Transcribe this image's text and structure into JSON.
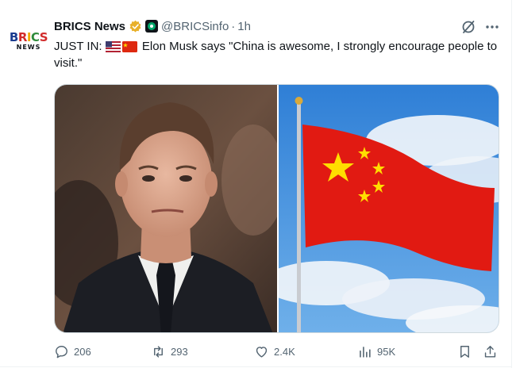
{
  "tweet": {
    "author": {
      "display_name": "BRICS News",
      "handle": "@BRICSinfo",
      "time": "1h",
      "dot": "·",
      "avatar_logo_top": "BRICS",
      "avatar_logo_bottom": "NEWS",
      "verified_badge_color": "#e8b02a",
      "affiliate_badge_color": "#00a86b",
      "icons": [
        "gold-verified-badge-icon",
        "affiliate-badge-icon",
        "grok-icon",
        "more-icon"
      ]
    },
    "text_prefix": "JUST IN:",
    "text_flags": [
      "us-flag-icon",
      "china-flag-icon"
    ],
    "text_body": "Elon Musk says \"China is awesome, I strongly encourage people to visit.\"",
    "media": {
      "left_image": "elon-musk-photo",
      "right_image": "china-flag-photo"
    },
    "actions": {
      "replies": "206",
      "reposts": "293",
      "likes": "2.4K",
      "views": "95K",
      "icons": [
        "reply-icon",
        "repost-icon",
        "like-icon",
        "views-icon",
        "bookmark-icon",
        "share-icon"
      ]
    }
  },
  "colors": {
    "text": "#0f1419",
    "muted": "#536471",
    "border": "#cfd9de"
  }
}
